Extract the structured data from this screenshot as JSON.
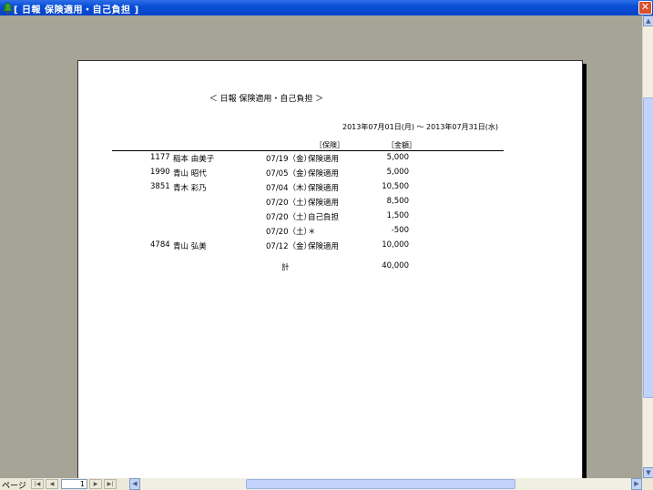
{
  "window": {
    "title": "[ 日報  保険適用・自己負担 ]",
    "close_glyph": "✕",
    "icon": "tree-icon"
  },
  "report": {
    "title": "＜ 日報  保険適用・自己負担 ＞",
    "period": "2013年07月01日(月)  ～  2013年07月31日(水)",
    "headers": {
      "insurance": "［保険］",
      "amount": "［金額］"
    },
    "rows": [
      {
        "id": "1177",
        "name": "稲本 由美子",
        "date": "07/19（金）",
        "kind": "保険適用",
        "amount": "5,000"
      },
      {
        "id": "1990",
        "name": "青山 昭代",
        "date": "07/05（金）",
        "kind": "保険適用",
        "amount": "5,000"
      },
      {
        "id": "3851",
        "name": "青木 彩乃",
        "date": "07/04（木）",
        "kind": "保険適用",
        "amount": "10,500"
      },
      {
        "id": "",
        "name": "",
        "date": "07/20（土）",
        "kind": "保険適用",
        "amount": "8,500"
      },
      {
        "id": "",
        "name": "",
        "date": "07/20（土）",
        "kind": "自己負担",
        "amount": "1,500"
      },
      {
        "id": "",
        "name": "",
        "date": "07/20（土）",
        "kind": "＊",
        "amount": "-500"
      },
      {
        "id": "4784",
        "name": "青山 弘美",
        "date": "07/12（金）",
        "kind": "保険適用",
        "amount": "10,000"
      }
    ],
    "total_label": "計",
    "total_value": "40,000"
  },
  "footer": {
    "page_label": "ページ",
    "page_value": "1",
    "nav": {
      "first": "|◀",
      "prev": "◀",
      "next": "▶",
      "last": "▶|"
    },
    "scroll_left": "◀",
    "scroll_right": "▶"
  },
  "vscroll": {
    "up": "▲",
    "down": "▼"
  }
}
